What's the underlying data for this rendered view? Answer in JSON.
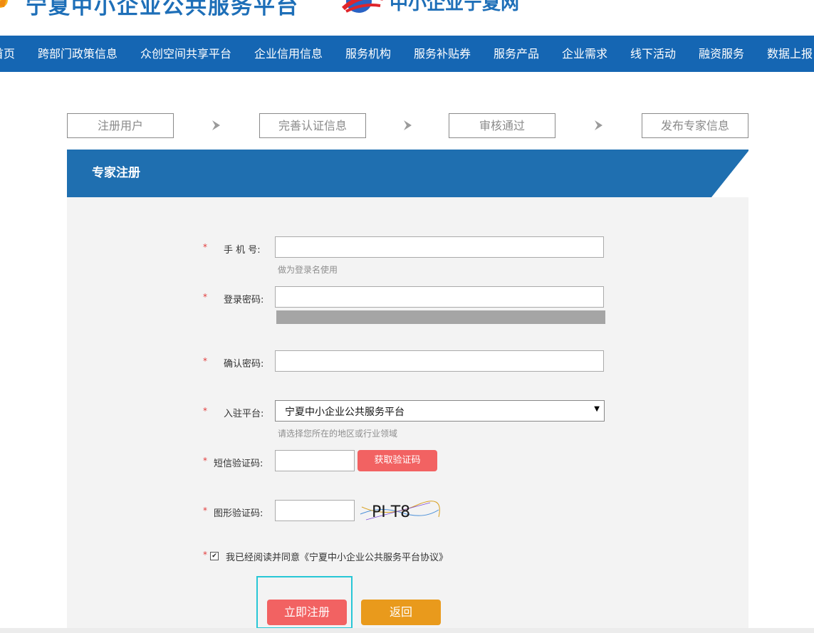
{
  "header": {
    "site_title": "宁夏中小企业公共服务平台",
    "net_title": "中小企业宁夏网",
    "logo_icon": "sun-logo-icon",
    "net_logo_icon": "globe-logo-icon"
  },
  "nav": {
    "items": [
      "首页",
      "跨部门政策信息",
      "众创空间共享平台",
      "企业信用信息",
      "服务机构",
      "服务补贴券",
      "服务产品",
      "企业需求",
      "线下活动",
      "融资服务",
      "数据上报"
    ]
  },
  "steps": {
    "items": [
      "注册用户",
      "完善认证信息",
      "审核通过",
      "发布专家信息"
    ],
    "arrow_icon": "chevron-right-icon"
  },
  "panel": {
    "title": "专家注册"
  },
  "form": {
    "required_mark": "*",
    "phone": {
      "label": "手 机 号:",
      "hint": "做为登录名使用",
      "value": ""
    },
    "password": {
      "label": "登录密码:",
      "value": ""
    },
    "confirm": {
      "label": "确认密码:",
      "value": ""
    },
    "platform": {
      "label": "入驻平台:",
      "selected": "宁夏中小企业公共服务平台",
      "hint": "请选择您所在的地区或行业领域"
    },
    "sms": {
      "label": "短信验证码:",
      "button": "获取验证码",
      "value": ""
    },
    "captcha": {
      "label": "图形验证码:",
      "image_text": "PI T8",
      "value": ""
    },
    "agree": {
      "checked": true,
      "text": "我已经阅读并同意《宁夏中小企业公共服务平台协议》"
    }
  },
  "buttons": {
    "register": "立即注册",
    "back": "返回"
  },
  "colors": {
    "nav_bg": "#1566b3",
    "panel_header": "#1f6fb0",
    "accent_red": "#f26262",
    "accent_orange": "#e99a1c",
    "focus": "#27c7d6"
  }
}
